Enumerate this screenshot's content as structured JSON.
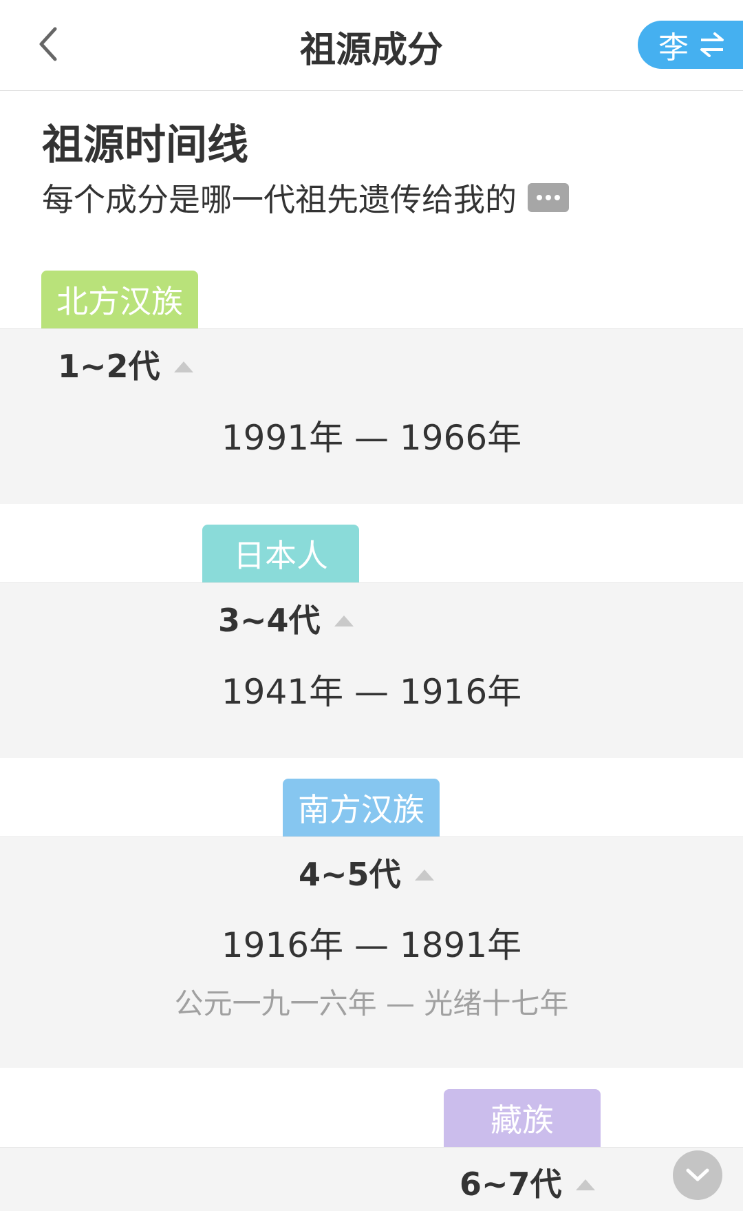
{
  "header": {
    "title": "祖源成分",
    "switch_label": "李"
  },
  "section": {
    "title": "祖源时间线",
    "subtitle": "每个成分是哪一代祖先遗传给我的"
  },
  "timeline": [
    {
      "tag": "北方汉族",
      "tag_color": "#b9e27a",
      "generation": "1~2代",
      "years": "1991年 — 1966年"
    },
    {
      "tag": "日本人",
      "tag_color": "#8adbd9",
      "generation": "3~4代",
      "years": "1941年 — 1916年"
    },
    {
      "tag": "南方汉族",
      "tag_color": "#86c6f0",
      "generation": "4~5代",
      "years": "1916年 — 1891年",
      "era": "公元一九一六年 — 光绪十七年"
    },
    {
      "tag": "藏族",
      "tag_color": "#cbbdec",
      "generation": "6~7代"
    }
  ],
  "colors": {
    "accent": "#45b0f0",
    "band_bg": "#f4f4f4"
  }
}
